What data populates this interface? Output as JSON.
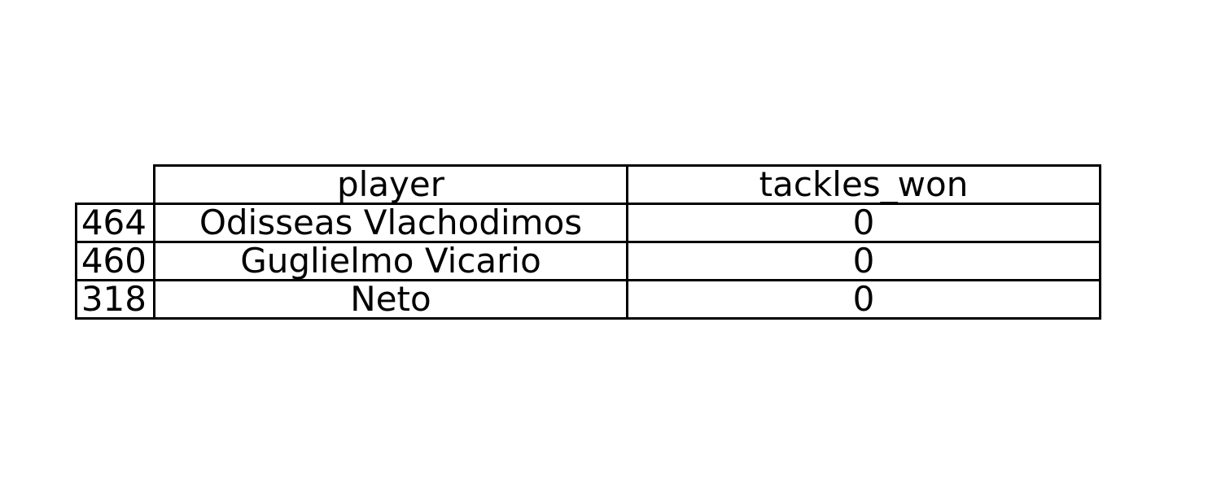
{
  "chart_data": {
    "type": "table",
    "columns": [
      "player",
      "tackles_won"
    ],
    "rows": [
      {
        "index": "464",
        "player": "Odisseas Vlachodimos",
        "tackles_won": "0"
      },
      {
        "index": "460",
        "player": "Guglielmo Vicario",
        "tackles_won": "0"
      },
      {
        "index": "318",
        "player": "Neto",
        "tackles_won": "0"
      }
    ]
  }
}
